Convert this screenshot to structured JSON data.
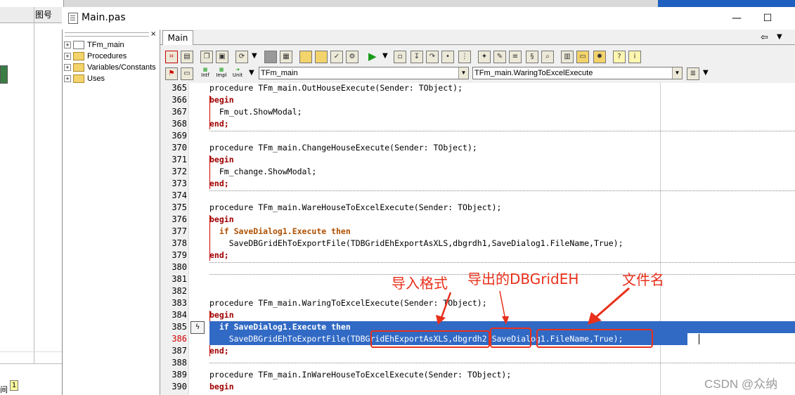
{
  "background_window": {
    "column_header": "图号",
    "status_box": "1",
    "status_char": "间"
  },
  "window": {
    "title": "Main.pas",
    "minimize_glyph": "—",
    "maximize_glyph": "☐"
  },
  "tree": {
    "close_glyph": "×",
    "items": [
      {
        "label": "TFm_main",
        "expander": "+"
      },
      {
        "label": "Procedures",
        "expander": "+"
      },
      {
        "label": "Variables/Constants",
        "expander": "+"
      },
      {
        "label": "Uses",
        "expander": "+"
      }
    ]
  },
  "tabs": [
    {
      "label": "Main"
    }
  ],
  "nav": {
    "back_glyph": "⇦",
    "drop_glyph": "▼"
  },
  "toolbar": {
    "class_combo": "TFm_main",
    "method_combo": "TFm_main.WaringToExcelExecute",
    "btn_intf": "Intf",
    "btn_impl": "Impl",
    "btn_unit": "Unit"
  },
  "editor": {
    "lines": [
      {
        "no": "365",
        "text": "procedure TFm_main.OutHouseExecute(Sender: TObject);"
      },
      {
        "no": "366",
        "text": "begin"
      },
      {
        "no": "367",
        "text": "  Fm_out.ShowModal;"
      },
      {
        "no": "368",
        "text": "end;"
      },
      {
        "no": "369",
        "text": ""
      },
      {
        "no": "370",
        "text": "procedure TFm_main.ChangeHouseExecute(Sender: TObject);"
      },
      {
        "no": "371",
        "text": "begin"
      },
      {
        "no": "372",
        "text": "  Fm_change.ShowModal;"
      },
      {
        "no": "373",
        "text": "end;"
      },
      {
        "no": "374",
        "text": ""
      },
      {
        "no": "375",
        "text": "procedure TFm_main.WareHouseToExcelExecute(Sender: TObject);"
      },
      {
        "no": "376",
        "text": "begin"
      },
      {
        "no": "377",
        "text": "  if SaveDialog1.Execute then"
      },
      {
        "no": "378",
        "text": "    SaveDBGridEhToExportFile(TDBGridEhExportAsXLS,dbgrdh1,SaveDialog1.FileName,True);"
      },
      {
        "no": "379",
        "text": "end;"
      },
      {
        "no": "380",
        "text": ""
      },
      {
        "no": "381",
        "text": ""
      },
      {
        "no": "382",
        "text": ""
      },
      {
        "no": "383",
        "text": "procedure TFm_main.WaringToExcelExecute(Sender: TObject);"
      },
      {
        "no": "384",
        "text": "begin"
      },
      {
        "no": "385",
        "text": "  if SaveDialog1.Execute then"
      },
      {
        "no": "386",
        "text": "    SaveDBGridEhToExportFile(TDBGridEhExportAsXLS,dbgrdh2,SaveDialog1.FileName,True);"
      },
      {
        "no": "387",
        "text": "end;"
      },
      {
        "no": "388",
        "text": ""
      },
      {
        "no": "389",
        "text": "procedure TFm_main.InWareHouseToExcelExecute(Sender: TObject);"
      },
      {
        "no": "390",
        "text": "begin"
      }
    ],
    "highlighted_line": "386"
  },
  "annotations": {
    "import_format": "导入格式",
    "export_grid": "导出的DBGridEH",
    "file_name": "文件名",
    "color": "#e8301b"
  },
  "watermark": "CSDN @众纳"
}
